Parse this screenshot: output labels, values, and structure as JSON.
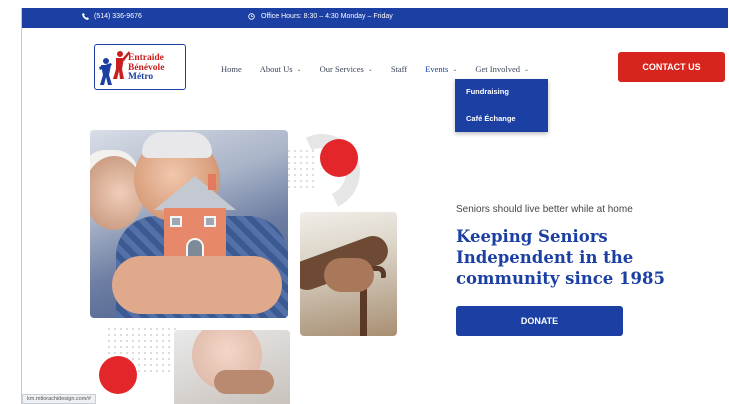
{
  "topbar": {
    "phone_icon": "phone-icon",
    "phone": "(514) 336-9676",
    "clock_icon": "clock-icon",
    "hours": "Office Hours: 8:30 – 4:30 Monday – Friday"
  },
  "logo": {
    "line1": "Entraide",
    "line2": "Bénévole",
    "line3": "Métro"
  },
  "nav": {
    "items": [
      {
        "label": "Home",
        "has_dropdown": false
      },
      {
        "label": "About Us",
        "has_dropdown": true
      },
      {
        "label": "Our Services",
        "has_dropdown": true
      },
      {
        "label": "Staff",
        "has_dropdown": false
      },
      {
        "label": "Events",
        "has_dropdown": true
      },
      {
        "label": "Get Involved",
        "has_dropdown": true
      }
    ],
    "caret": "⌄",
    "events_menu": [
      "Fundraising",
      "Café Échange"
    ]
  },
  "contact_button": "CONTACT US",
  "hero": {
    "tagline": "Seniors should live better while at home",
    "headline": "Keeping Seniors Independent in the community since 1985",
    "donate_button": "DONATE"
  },
  "status_url": "km.mtlorachidesign.com/#",
  "colors": {
    "brand_blue": "#1b3fa3",
    "accent_red": "#e2262a",
    "contact_red": "#d7241c"
  }
}
